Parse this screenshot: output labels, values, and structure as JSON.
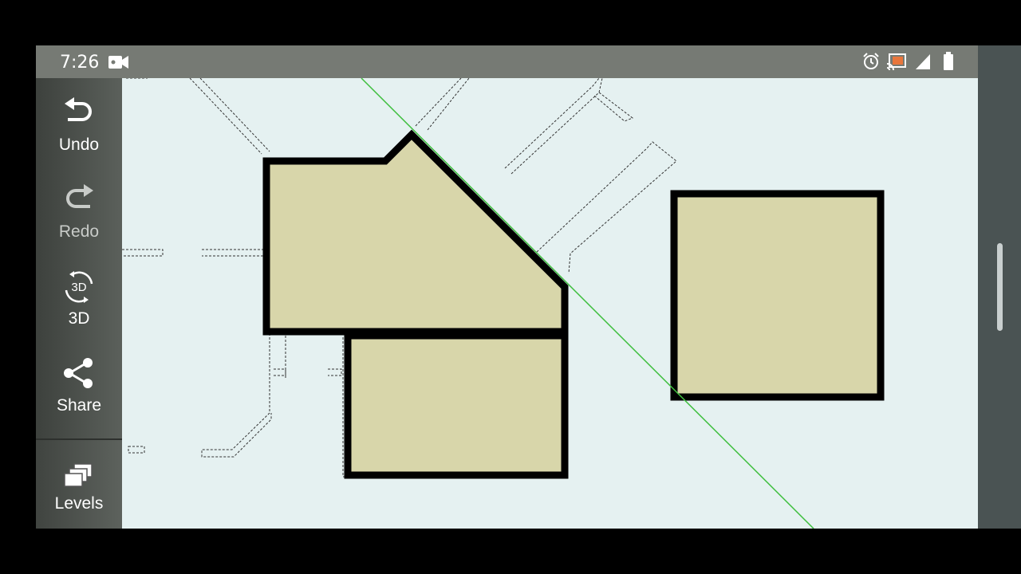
{
  "status": {
    "time": "7:26",
    "icons": [
      "video-camera-icon",
      "alarm-icon",
      "cast-icon",
      "signal-icon",
      "battery-icon"
    ]
  },
  "toolbar": {
    "undo_label": "Undo",
    "redo_label": "Redo",
    "threed_label": "3D",
    "threed_icon_text": "3D",
    "share_label": "Share",
    "levels_label": "Levels"
  },
  "colors": {
    "canvas": "#e5f1f1",
    "room_fill": "#d8d6aa",
    "wall": "#000000",
    "guide_line": "#3fbf3f",
    "statusbar": "#767a74",
    "toolbar": "#4a4e4a"
  }
}
